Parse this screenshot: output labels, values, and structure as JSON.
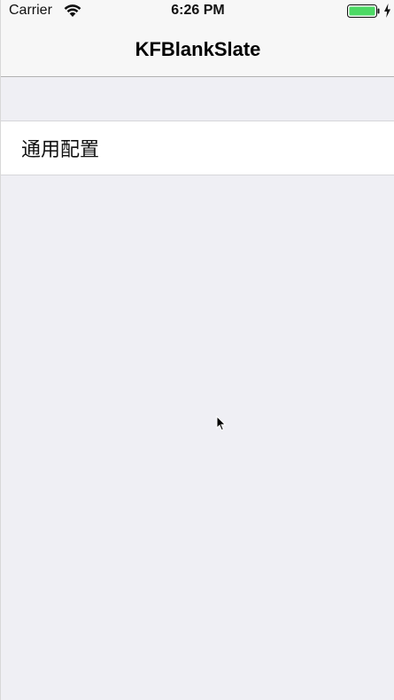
{
  "status_bar": {
    "carrier": "Carrier",
    "time": "6:26 PM",
    "wifi_icon": "wifi-icon",
    "battery_icon": "battery-icon",
    "charging_icon": "charging-bolt-icon",
    "battery_level": 1.0,
    "battery_color": "#4cd964"
  },
  "nav_bar": {
    "title": "KFBlankSlate"
  },
  "table": {
    "cells": [
      {
        "label": "通用配置"
      }
    ]
  },
  "colors": {
    "background": "#efeff4",
    "bar_background": "#f7f7f7",
    "separator": "#d6d6da"
  }
}
